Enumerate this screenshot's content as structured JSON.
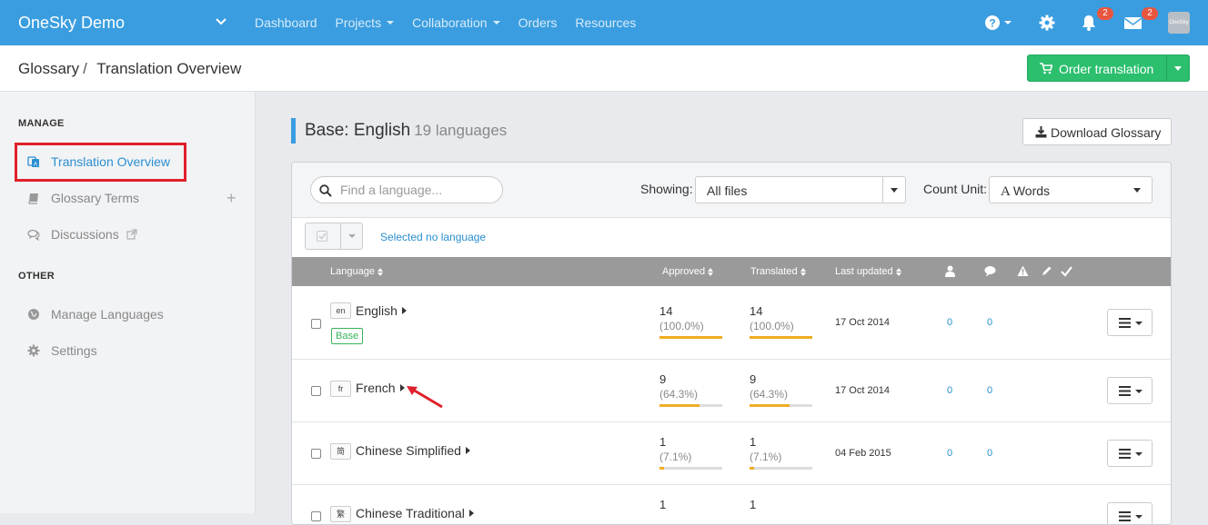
{
  "app": {
    "title": "OneSky Demo",
    "nav": [
      "Dashboard",
      "Projects",
      "Collaboration",
      "Orders",
      "Resources"
    ],
    "nav_has_caret": [
      false,
      true,
      true,
      false,
      false
    ],
    "notifications_count": "2",
    "messages_count": "2",
    "avatar_text": "OneSky"
  },
  "header": {
    "breadcrumb_root": "Glossary",
    "breadcrumb_sep": "/",
    "breadcrumb_current": "Translation Overview",
    "order_button": "Order translation"
  },
  "sidebar": {
    "manage_title": "MANAGE",
    "items": [
      "Translation Overview",
      "Glossary Terms",
      "Discussions"
    ],
    "other_title": "OTHER",
    "other_items": [
      "Manage Languages",
      "Settings"
    ]
  },
  "main": {
    "base_label": "Base: English",
    "languages_count": "19 languages",
    "download_button": "Download Glossary",
    "search_placeholder": "Find a language...",
    "showing_label": "Showing:",
    "showing_value": "All files",
    "count_unit_label": "Count Unit:",
    "count_unit_value": "Words",
    "selected_status": "Selected no language",
    "columns": {
      "language": "Language",
      "approved": "Approved",
      "translated": "Translated",
      "last_updated": "Last updated"
    },
    "rows": [
      {
        "code": "en",
        "name": "English",
        "base": "Base",
        "approved": "14",
        "approved_pct": "(100.0%)",
        "approved_frac": 1.0,
        "translated": "14",
        "translated_pct": "(100.0%)",
        "translated_frac": 1.0,
        "updated": "17 Oct 2014",
        "c1": "0",
        "c2": "0"
      },
      {
        "code": "fr",
        "name": "French",
        "approved": "9",
        "approved_pct": "(64.3%)",
        "approved_frac": 0.643,
        "translated": "9",
        "translated_pct": "(64.3%)",
        "translated_frac": 0.643,
        "updated": "17 Oct 2014",
        "c1": "0",
        "c2": "0"
      },
      {
        "code": "简",
        "name": "Chinese Simplified",
        "approved": "1",
        "approved_pct": "(7.1%)",
        "approved_frac": 0.071,
        "translated": "1",
        "translated_pct": "(7.1%)",
        "translated_frac": 0.071,
        "updated": "04 Feb 2015",
        "c1": "0",
        "c2": "0"
      },
      {
        "code": "繁",
        "name": "Chinese Traditional",
        "approved": "1",
        "translated": "1"
      }
    ]
  },
  "colors": {
    "nav_blue": "#3a9de0",
    "green": "#2bbf6e",
    "link_blue": "#2a8fd0",
    "bar_orange": "#f0ad22",
    "highlight_red": "#e0202a"
  }
}
